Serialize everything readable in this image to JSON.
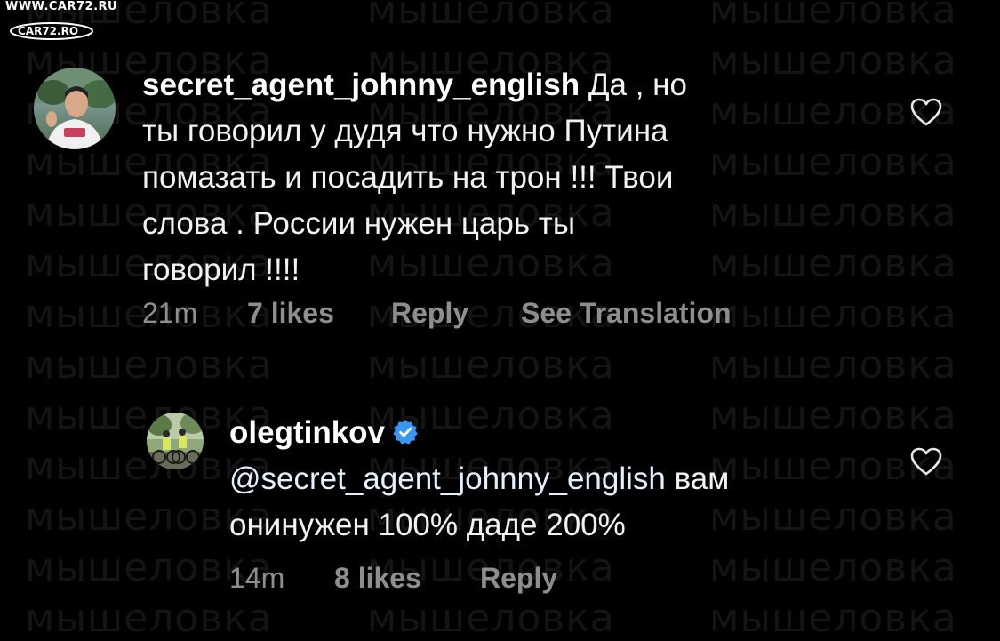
{
  "watermark": {
    "text": "мышеловка"
  },
  "site_logo": {
    "url": "WWW.CAR72.RU",
    "badge": "CAR72.RO"
  },
  "comments": [
    {
      "username": "secret_agent_johnny_english",
      "text_line1_after_username": "Да , но",
      "lines": [
        "ты говорил у дудя что нужно Путина",
        "помазать и посадить на трон !!! Твои",
        "слова . России нужен царь ты",
        "говорил !!!!"
      ],
      "time": "21m",
      "likes": "7 likes",
      "reply": "Reply",
      "see_translation": "See Translation"
    },
    {
      "username": "olegtinkov",
      "verified": true,
      "mention": "@secret_agent_johnny_english",
      "text_after_mention": " вам",
      "line2": "онинужен 100% даде 200%",
      "time": "14m",
      "likes": "8 likes",
      "reply": "Reply"
    }
  ],
  "colors": {
    "background": "#000000",
    "text": "#f2f2f2",
    "meta": "#8e8e8e",
    "verified": "#3897f0",
    "watermark": "#141414"
  },
  "icons": [
    "heart-outline-icon",
    "verified-badge-icon"
  ]
}
